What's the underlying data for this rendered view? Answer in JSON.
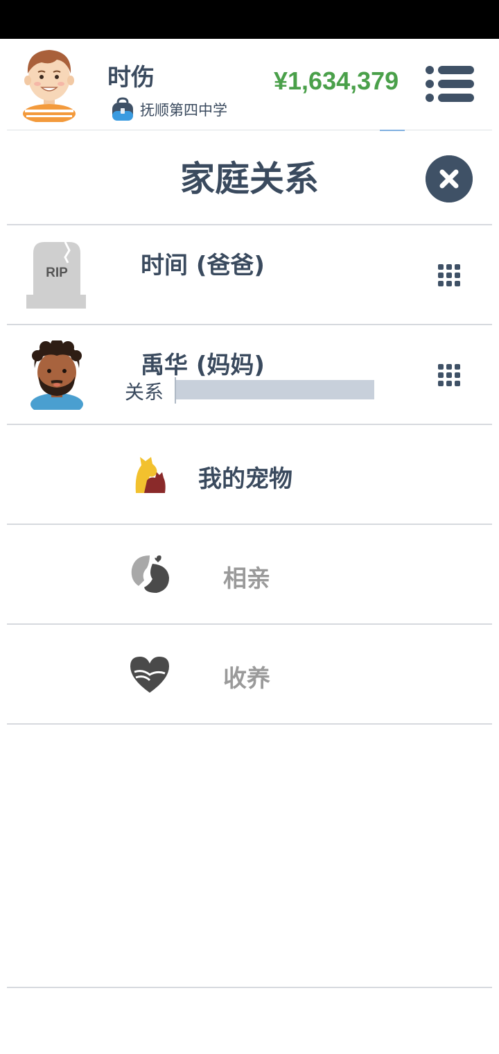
{
  "header": {
    "username": "时伤",
    "school": "抚顺第四中学",
    "money": "¥1,634,379"
  },
  "page": {
    "title": "家庭关系"
  },
  "members": [
    {
      "name": "时间 (爸爸)",
      "status": "deceased",
      "icon": "tombstone-rip-icon",
      "rip_text": "RIP"
    },
    {
      "name": "禹华 (妈妈)",
      "icon": "mother-avatar-icon",
      "relation_label": "关系",
      "relation_level": 0
    }
  ],
  "options": [
    {
      "label": "我的宠物",
      "icon": "pets-icon",
      "enabled": true
    },
    {
      "label": "相亲",
      "icon": "dating-icon",
      "enabled": false
    },
    {
      "label": "收养",
      "icon": "adoption-heart-icon",
      "enabled": false
    }
  ],
  "colors": {
    "text": "#3a4a5e",
    "money": "#4aa04a",
    "disabled": "#9a9a9a",
    "close_button": "#3f5166",
    "divider": "#d6d9de"
  }
}
